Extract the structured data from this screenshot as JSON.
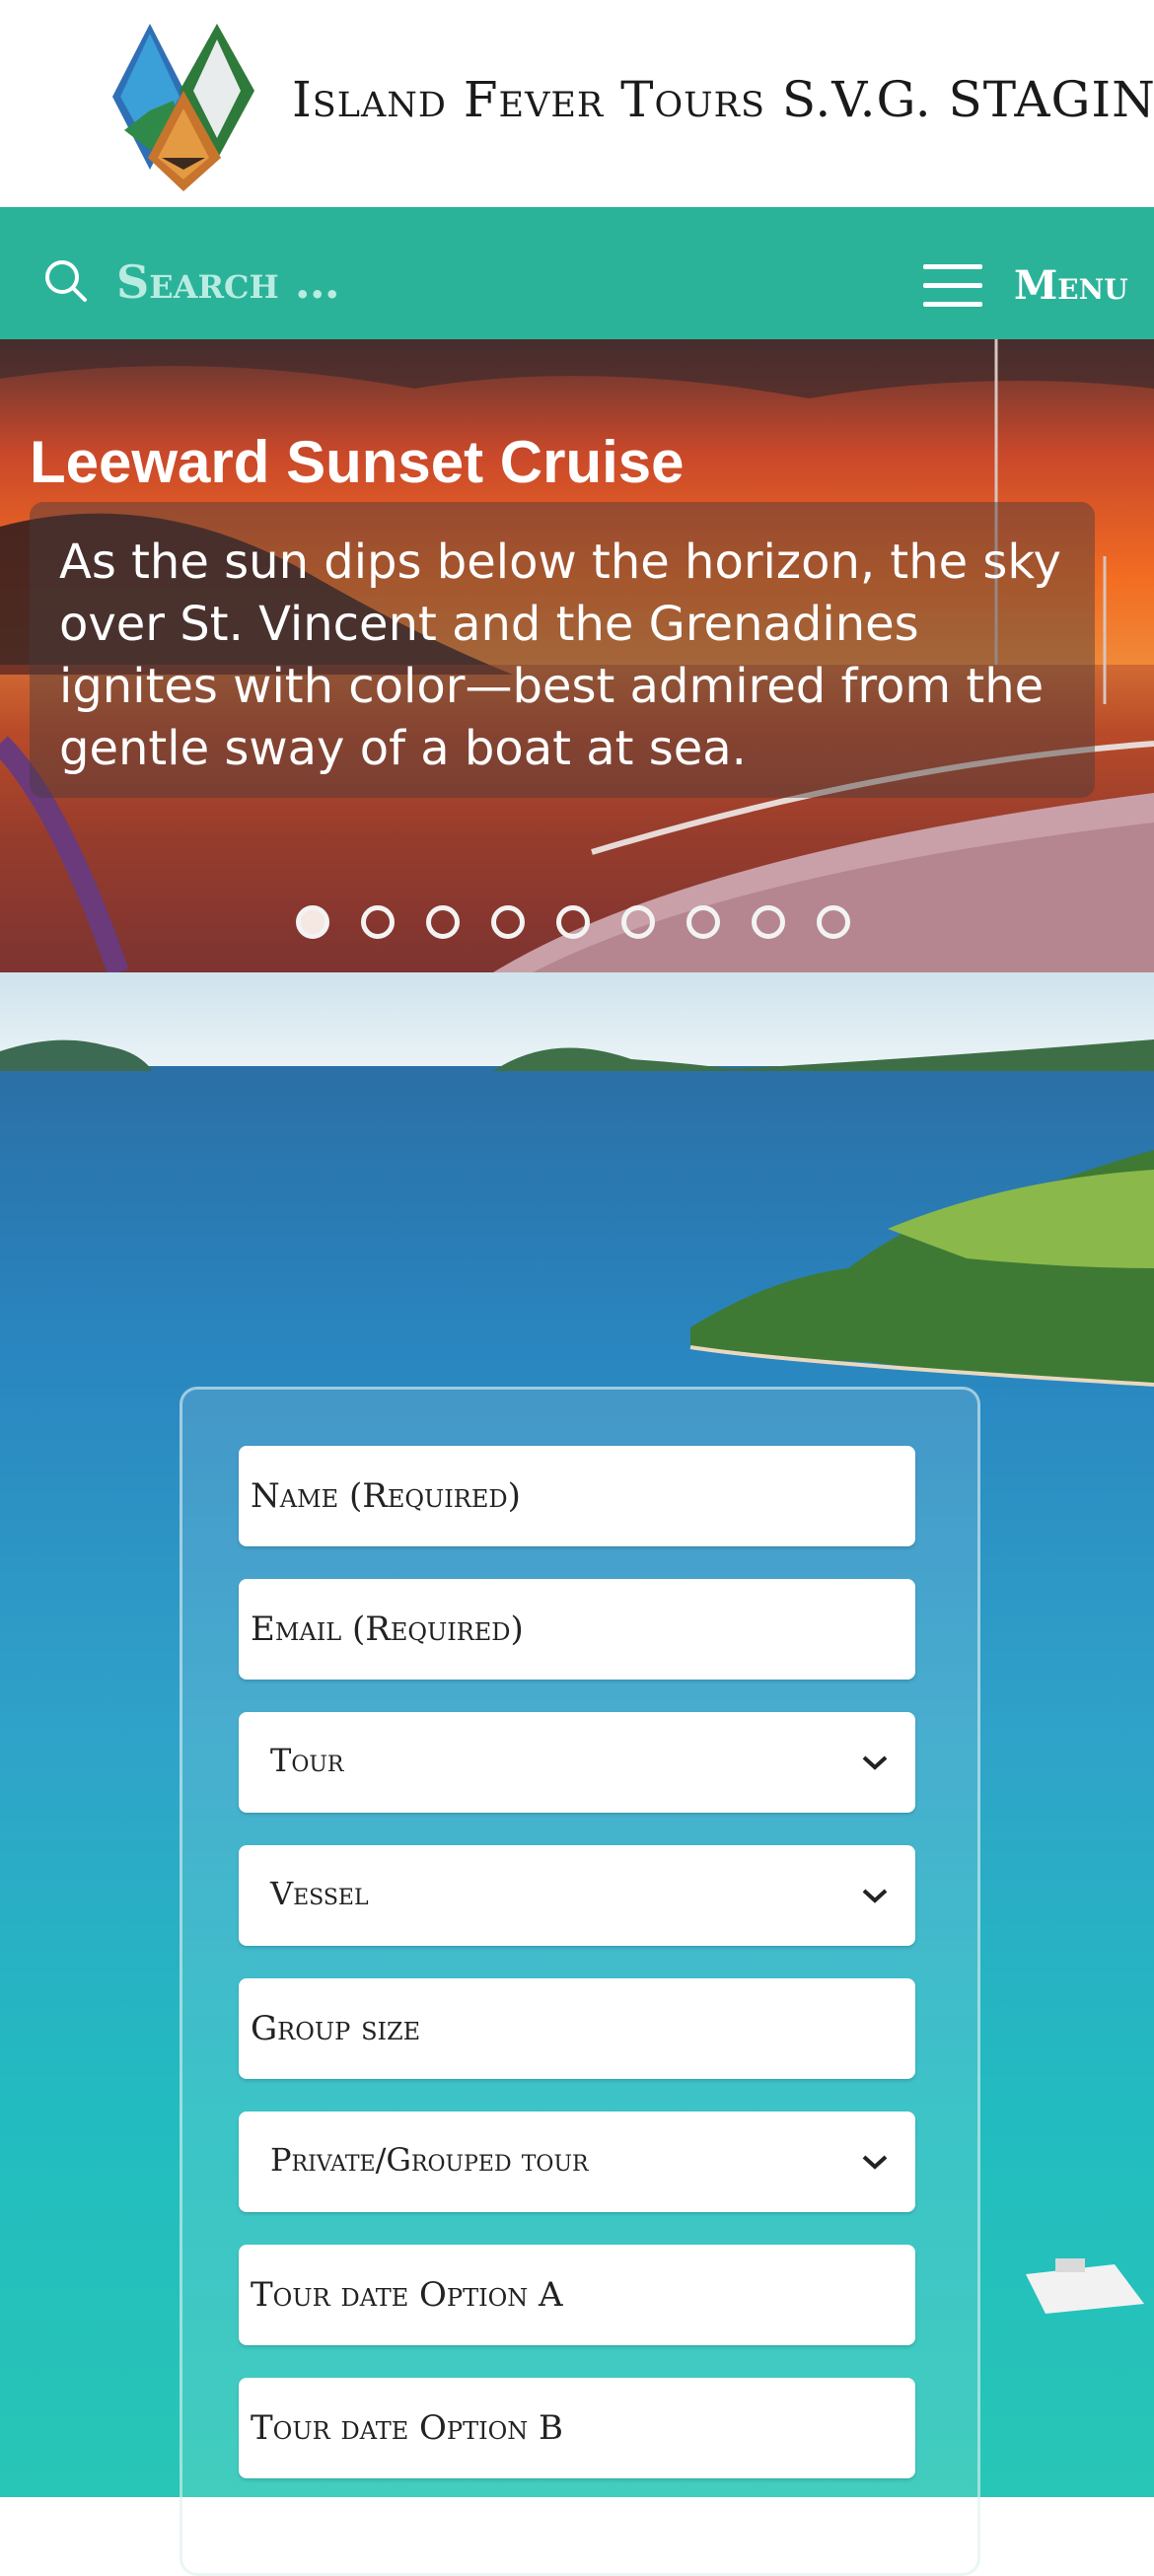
{
  "header": {
    "site_title": "Island Fever Tours S.V.G. STAGING",
    "logo_icon": "diamond-tiles-logo"
  },
  "nav": {
    "search_placeholder": "Search …",
    "search_icon": "search-icon",
    "menu_label": "Menu",
    "menu_icon": "hamburger-icon",
    "bar_color": "#2bb39a"
  },
  "slider": {
    "title": "Leeward Sunset Cruise",
    "caption": "As the sun dips below the horizon, the sky over St. Vincent and the Grenadines ignites with color—best admired from the gentle sway of a boat at sea.",
    "slide_count": 9,
    "active_slide": 1
  },
  "form": {
    "name_placeholder": "Name (Required)",
    "email_placeholder": "Email (Required)",
    "tour_label": "Tour",
    "vessel_label": "Vessel",
    "group_size_placeholder": "Group size",
    "tour_type_label": "Private/Grouped tour",
    "date_a_placeholder": "Tour date Option A",
    "date_b_placeholder": "Tour date Option B"
  }
}
